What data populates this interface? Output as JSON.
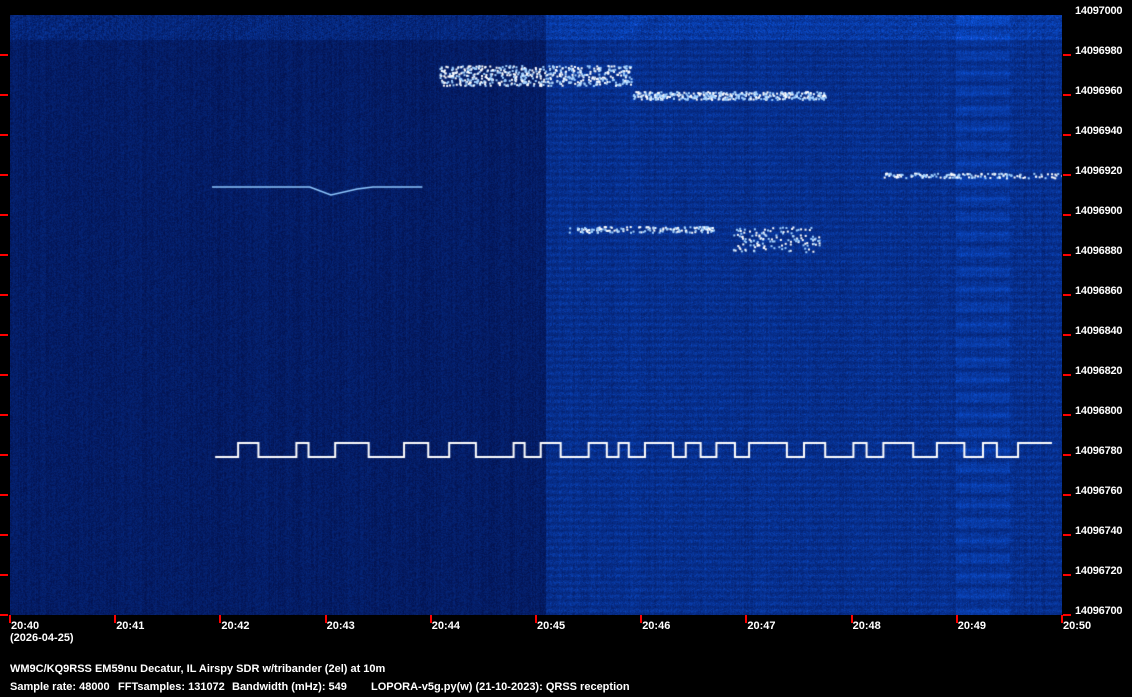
{
  "chart_data": {
    "type": "heatmap",
    "title": "QRSS waterfall spectrogram",
    "x_ticks": [
      "20:40",
      "20:41",
      "20:42",
      "20:43",
      "20:44",
      "20:45",
      "20:46",
      "20:47",
      "20:48",
      "20:49",
      "20:50"
    ],
    "date_label": "(2026-04-25)",
    "y_ticks": [
      14097000,
      14096980,
      14096960,
      14096940,
      14096920,
      14096900,
      14096880,
      14096860,
      14096840,
      14096820,
      14096800,
      14096780,
      14096760,
      14096740,
      14096720,
      14096700
    ],
    "xlim_minutes": [
      0,
      10
    ],
    "ylim_hz": [
      14096700,
      14097000
    ],
    "colormap": [
      "#000c30",
      "#0a2a6a",
      "#3f7fd0",
      "#ffffff"
    ],
    "signals": [
      {
        "name": "FSK trace near 14096780",
        "t_start": 1.95,
        "t_end": 9.78,
        "f_low": 14096780,
        "f_high": 14096784
      },
      {
        "name": "trace near 14096914",
        "t_start": 1.92,
        "t_end": 3.92,
        "f": 14096914
      },
      {
        "name": "burst near 14096970",
        "t_start": 4.05,
        "t_end": 5.9,
        "f": 14096970
      },
      {
        "name": "FSK near 14096960",
        "t_start": 5.92,
        "t_end": 7.75,
        "f": 14096960
      },
      {
        "name": "trace near 14096895",
        "t_start": 5.3,
        "t_end": 6.7,
        "f": 14096893
      },
      {
        "name": "burst near 14096888",
        "t_start": 6.85,
        "t_end": 7.7,
        "f": 14096888
      },
      {
        "name": "line near 14096920",
        "t_start": 8.3,
        "t_end": 10,
        "f": 14096920
      },
      {
        "name": "noise floor step",
        "t_start": 5.0,
        "t_end": 10
      }
    ]
  },
  "info": {
    "line1": "WM9C/KQ9RSS EM59nu Decatur, IL  Airspy SDR w/tribander (2el) at 10m",
    "sample_rate": "Sample rate: 48000",
    "fft": "FFTsamples: 131072",
    "bandwidth": "Bandwidth (mHz): 549",
    "software": "LOPORA-v5g.py(w) (21-10-2023): QRSS reception"
  }
}
